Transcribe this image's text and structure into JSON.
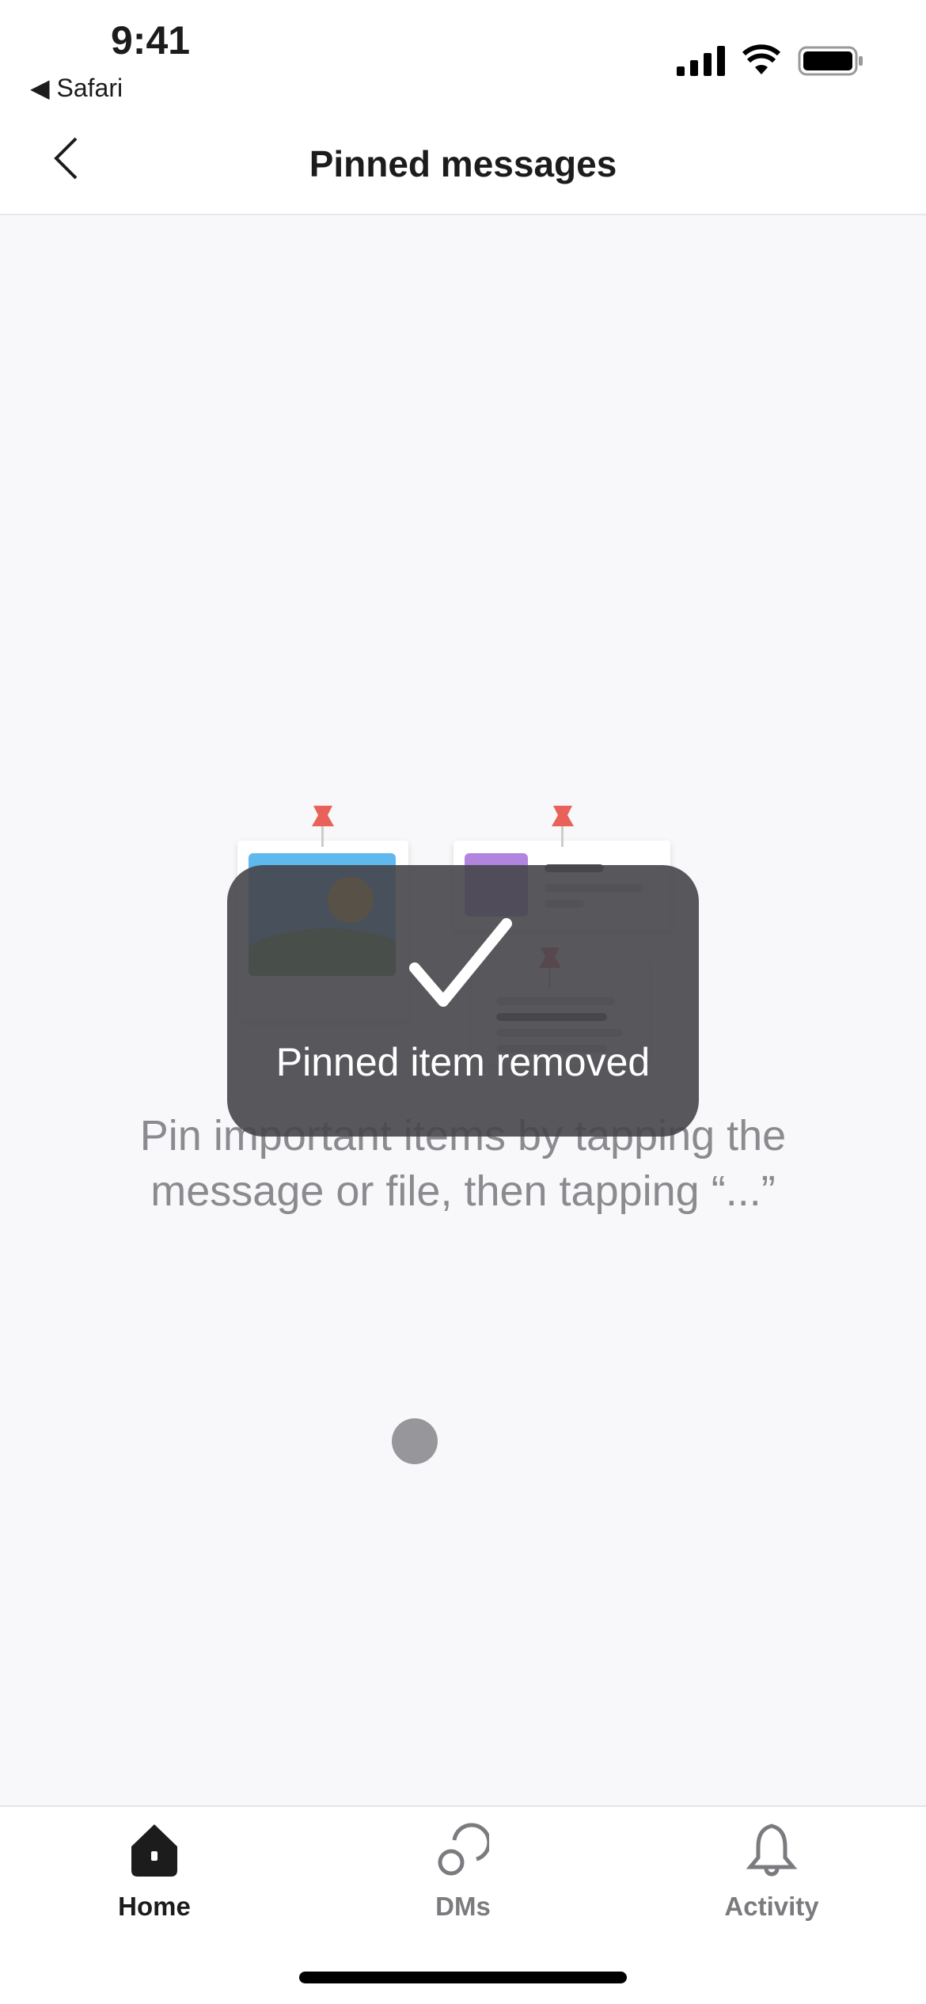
{
  "status_bar": {
    "time": "9:41",
    "back_app": "Safari"
  },
  "header": {
    "title": "Pinned messages"
  },
  "toast": {
    "message": "Pinned item removed",
    "icon": "checkmark-icon"
  },
  "empty_state": {
    "text": "Pin important items by tapping the message or file, then tapping “...”"
  },
  "colors": {
    "pin": "#e8625a",
    "accent_dark": "#1d1c1d"
  },
  "tabbar": {
    "items": [
      {
        "label": "Home",
        "icon": "home-icon",
        "active": true
      },
      {
        "label": "DMs",
        "icon": "dms-icon",
        "active": false
      },
      {
        "label": "Activity",
        "icon": "bell-icon",
        "active": false
      }
    ]
  }
}
